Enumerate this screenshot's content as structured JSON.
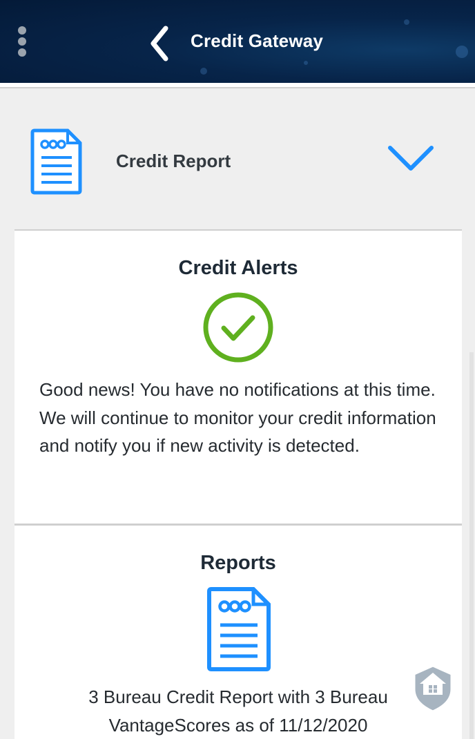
{
  "header": {
    "title": "Credit Gateway",
    "menu_icon": "more-vertical-icon",
    "back_icon": "chevron-left-icon"
  },
  "section": {
    "label": "Credit Report",
    "icon": "document-icon",
    "expand_icon": "chevron-down-icon"
  },
  "alerts": {
    "title": "Credit Alerts",
    "status_icon": "check-circle-icon",
    "message": "Good news! You have no notifications at this time. We will continue to monitor your credit information and notify you if new activity is detected."
  },
  "reports": {
    "title": "Reports",
    "icon": "document-icon",
    "report_title": "3 Bureau Credit Report with 3 Bureau VantageScores as of 11/12/2020"
  },
  "colors": {
    "header_bg": "#061d3d",
    "accent_blue": "#1e90ff",
    "success_green": "#5fb01f",
    "text_dark": "#1e2a36"
  },
  "watermark_icon": "house-shield-icon"
}
